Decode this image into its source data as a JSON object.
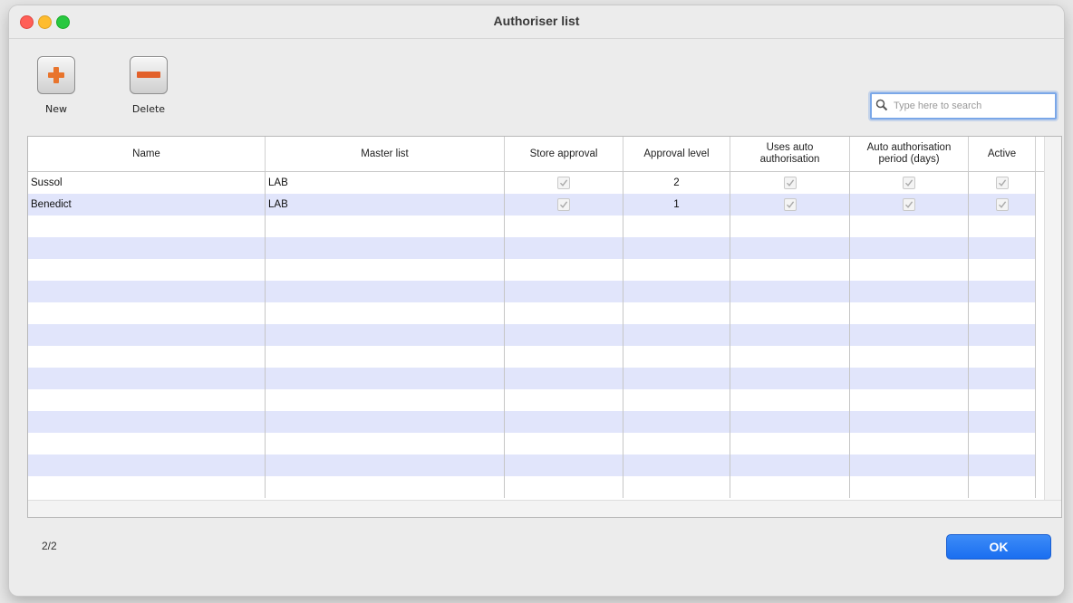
{
  "window": {
    "title": "Authoriser list"
  },
  "toolbar": {
    "new_label": "New",
    "delete_label": "Delete"
  },
  "search": {
    "placeholder": "Type here to search",
    "value": ""
  },
  "table": {
    "columns": [
      "Name",
      "Master list",
      "Store approval",
      "Approval level",
      "Uses auto authorisation",
      "Auto authorisation period (days)",
      "Active"
    ],
    "rows": [
      {
        "name": "Sussol",
        "master_list": "LAB",
        "store_approval": true,
        "approval_level": "2",
        "uses_auto_authorisation": true,
        "auto_period_days": true,
        "active": true
      },
      {
        "name": "Benedict",
        "master_list": "LAB",
        "store_approval": true,
        "approval_level": "1",
        "uses_auto_authorisation": true,
        "auto_period_days": true,
        "active": true
      }
    ]
  },
  "footer": {
    "record_count": "2/2",
    "ok_label": "OK"
  },
  "colors": {
    "row_alt": "#e1e5fb",
    "ok_button": "#1a6ef0",
    "add_icon": "#e8742c",
    "remove_icon": "#e2602a"
  }
}
